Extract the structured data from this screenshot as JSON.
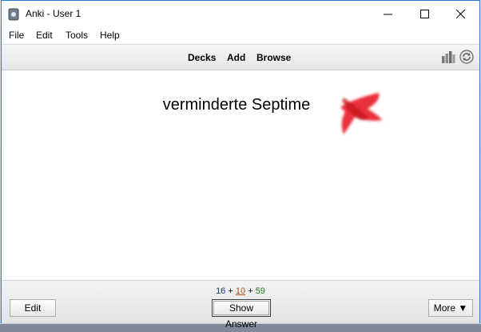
{
  "window": {
    "title": "Anki - User 1"
  },
  "menu": {
    "items": [
      "File",
      "Edit",
      "Tools",
      "Help"
    ]
  },
  "toolbar": {
    "decks": "Decks",
    "add": "Add",
    "browse": "Browse",
    "stats_icon": "stats-bar-icon",
    "sync_icon": "sync-icon"
  },
  "card": {
    "question": "verminderte Septime",
    "mark_color": "#e8202a"
  },
  "counts": {
    "new": "16",
    "learning": "10",
    "review": "59",
    "sep": "+"
  },
  "buttons": {
    "edit": "Edit",
    "show_answer": "Show Answer",
    "more": "More ▼"
  }
}
